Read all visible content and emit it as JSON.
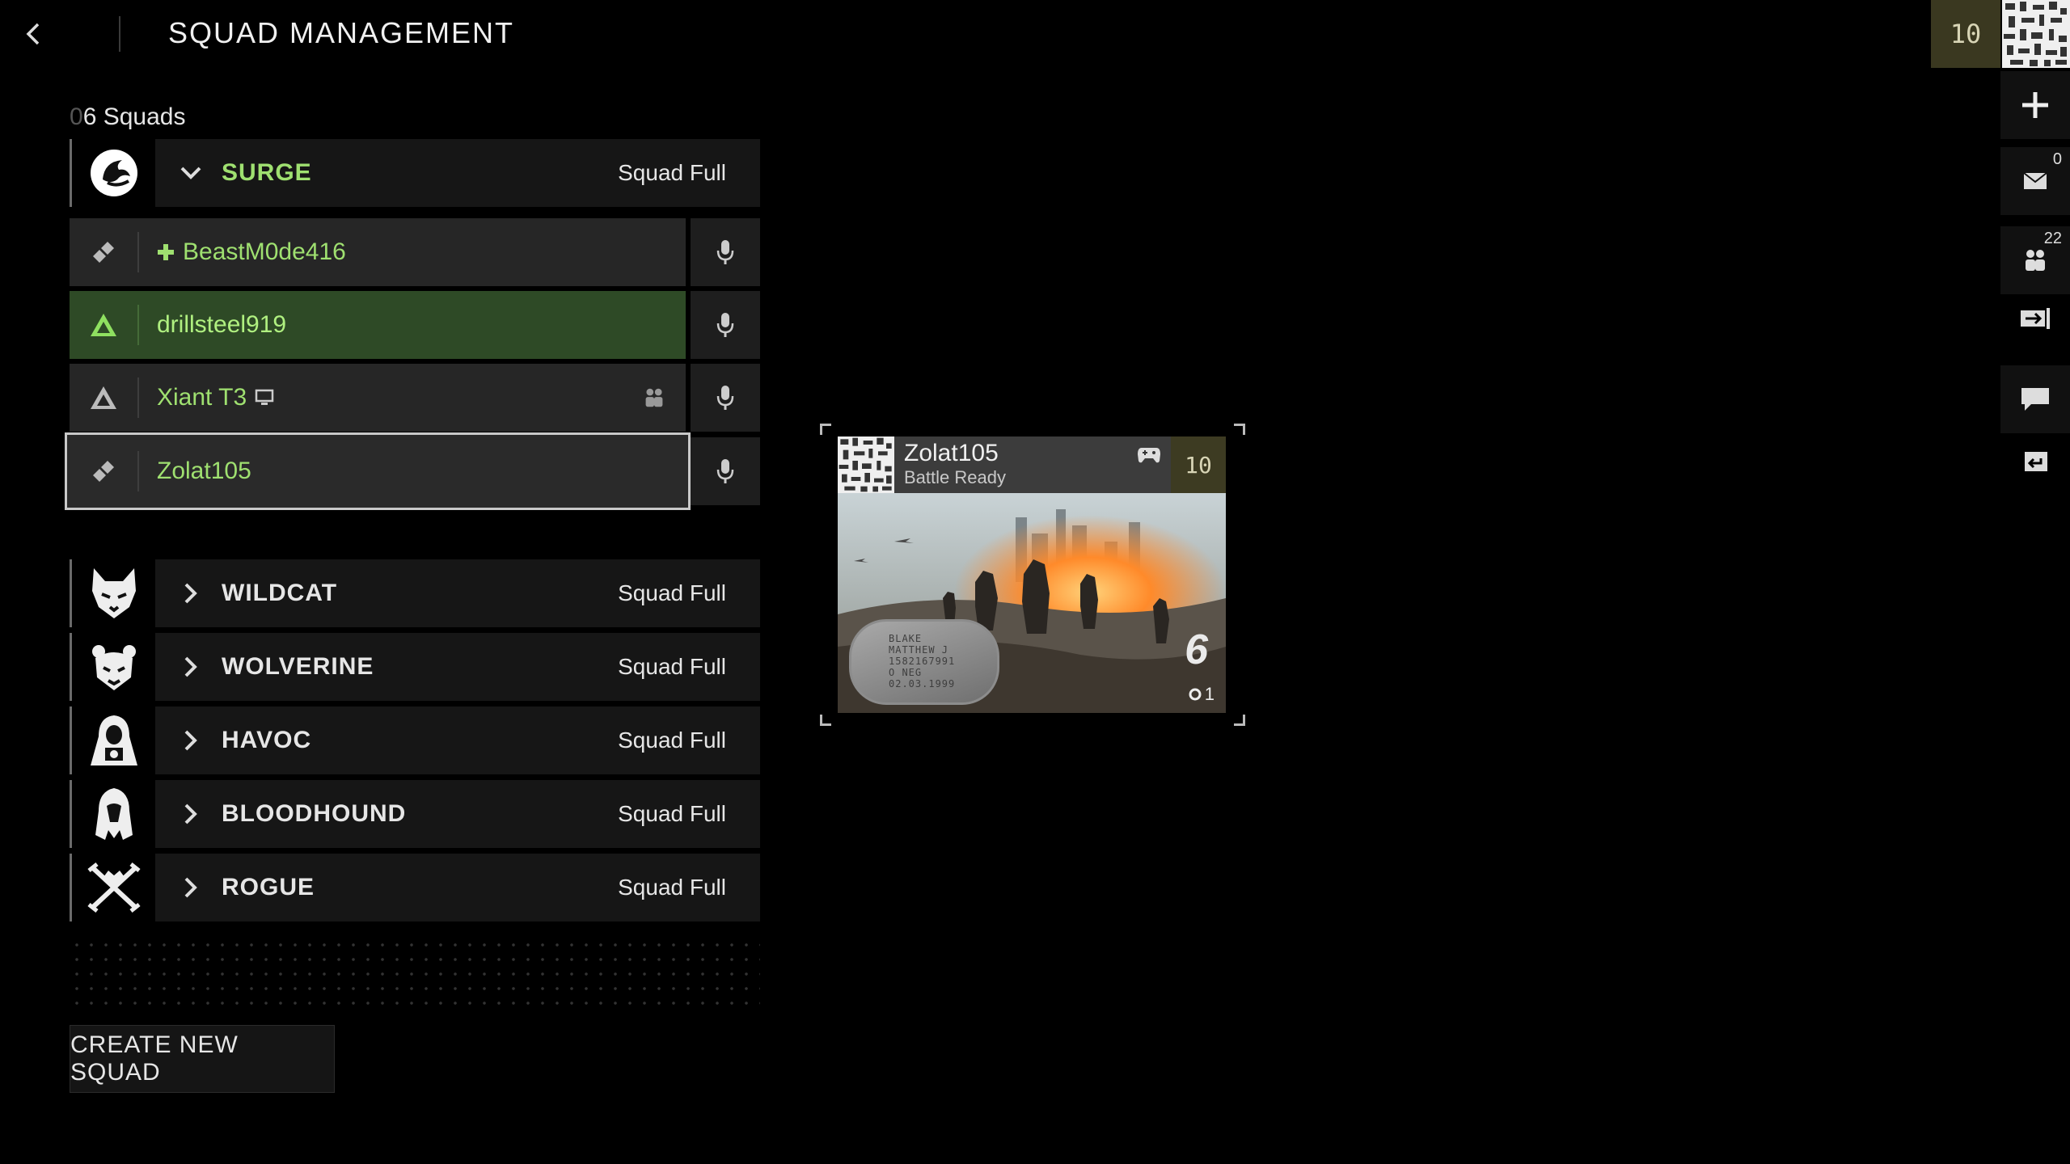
{
  "header": {
    "title": "SQUAD MANAGEMENT",
    "back_icon": "chevron-left-icon"
  },
  "rail": {
    "level": "10",
    "mail_count": "0",
    "friends_count": "22",
    "icons": [
      "plus-icon",
      "mail-icon",
      "friends-icon",
      "exit-icon",
      "chat-icon",
      "reply-icon"
    ]
  },
  "squads": {
    "count_prefix": "0",
    "count_suffix": "6 Squads",
    "expanded": {
      "name": "SURGE",
      "status": "Squad Full",
      "members": [
        {
          "name": "BeastM0de416",
          "role": "support",
          "leader": true
        },
        {
          "name": "drillsteel919",
          "role": "assault",
          "active": true
        },
        {
          "name": "Xiant T3",
          "role": "assault",
          "platform": "pc"
        },
        {
          "name": "Zolat105",
          "role": "support",
          "selected": true
        }
      ]
    },
    "collapsed": [
      {
        "name": "WILDCAT",
        "status": "Squad Full",
        "emblem": "wildcat-emblem-icon"
      },
      {
        "name": "WOLVERINE",
        "status": "Squad Full",
        "emblem": "wolverine-emblem-icon"
      },
      {
        "name": "HAVOC",
        "status": "Squad Full",
        "emblem": "havoc-emblem-icon"
      },
      {
        "name": "BLOODHOUND",
        "status": "Squad Full",
        "emblem": "bloodhound-emblem-icon"
      },
      {
        "name": "ROGUE",
        "status": "Squad Full",
        "emblem": "rogue-emblem-icon"
      }
    ],
    "create_label": "CREATE NEW SQUAD"
  },
  "card": {
    "name": "Zolat105",
    "status": "Battle Ready",
    "level": "10",
    "rank": "6",
    "prestige": "1",
    "dogtag_lines": [
      "BLAKE",
      "MATTHEW J",
      "1582167991",
      "O NEG",
      "02.03.1999"
    ]
  },
  "colors": {
    "accent_green": "#9fe070",
    "active_row": "#2e4a26",
    "level_badge": "#3a3820"
  }
}
